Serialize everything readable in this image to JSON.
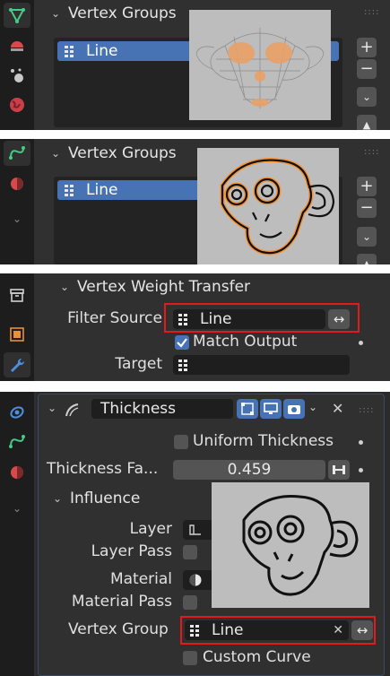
{
  "panel1": {
    "header": "Vertex Groups",
    "list_item": "Line",
    "add_label": "+",
    "remove_label": "−"
  },
  "panel2": {
    "header": "Vertex Groups",
    "list_item": "Line",
    "add_label": "+",
    "remove_label": "−"
  },
  "panel3": {
    "header": "Vertex Weight Transfer",
    "filter_source_label": "Filter Source",
    "filter_source_value": "Line",
    "swap_glyph": "↔",
    "match_output_label": "Match Output",
    "target_label": "Target"
  },
  "panel4": {
    "modifier_name": "Thickness",
    "close_glyph": "✕",
    "uniform_thickness_label": "Uniform Thickness",
    "thickness_factor_label": "Thickness Fa...",
    "thickness_factor_value": "0.459",
    "influence_header": "Influence",
    "layer_label": "Layer",
    "layer_pass_label": "Layer Pass",
    "material_label": "Material",
    "material_pass_label": "Material Pass",
    "vertex_group_label": "Vertex Group",
    "vertex_group_value": "Line",
    "clear_glyph": "✕",
    "swap_glyph": "↔",
    "custom_curve_label": "Custom Curve"
  },
  "colors": {
    "panel_bg": "#303030",
    "tab_bg": "#1d1d1d",
    "field_bg": "#1e1e1e",
    "button_bg": "#545454",
    "selection_blue": "#4772b3",
    "highlight_red": "#e11b1b",
    "mesh_orange": "#e8a066",
    "stroke_orange": "#ff8a1a"
  }
}
